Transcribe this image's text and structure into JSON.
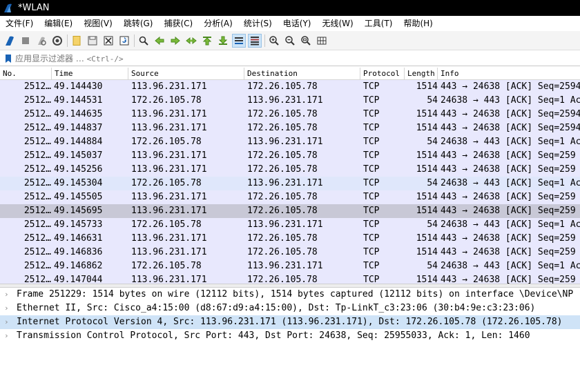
{
  "window": {
    "title": "*WLAN"
  },
  "menu": [
    "文件(F)",
    "编辑(E)",
    "视图(V)",
    "跳转(G)",
    "捕获(C)",
    "分析(A)",
    "统计(S)",
    "电话(Y)",
    "无线(W)",
    "工具(T)",
    "帮助(H)"
  ],
  "toolbar": {
    "icons": [
      "start-capture-icon",
      "stop-capture-icon",
      "restart-capture-icon",
      "capture-options-icon",
      "open-file-icon",
      "save-file-icon",
      "close-file-icon",
      "reload-file-icon",
      "find-packet-icon",
      "go-back-icon",
      "go-forward-icon",
      "go-to-packet-icon",
      "go-first-icon",
      "go-last-icon",
      "autoscroll-icon",
      "colorize-icon",
      "zoom-in-icon",
      "zoom-out-icon",
      "normal-size-icon",
      "resize-columns-icon"
    ],
    "active": [
      "autoscroll-icon",
      "colorize-icon"
    ]
  },
  "filter": {
    "placeholder": "应用显示过滤器 …",
    "shortcut": "<Ctrl-/>"
  },
  "packet_list": {
    "columns": [
      "No.",
      "Time",
      "Source",
      "Destination",
      "Protocol",
      "Length",
      "Info"
    ],
    "rows": [
      {
        "no": "2512…",
        "time": "49.144430",
        "src": "113.96.231.171",
        "dst": "172.26.105.78",
        "proto": "TCP",
        "len": "1514",
        "info": "443 → 24638 [ACK] Seq=2594"
      },
      {
        "no": "2512…",
        "time": "49.144531",
        "src": "172.26.105.78",
        "dst": "113.96.231.171",
        "proto": "TCP",
        "len": "54",
        "info": "24638 → 443 [ACK] Seq=1 Ac"
      },
      {
        "no": "2512…",
        "time": "49.144635",
        "src": "113.96.231.171",
        "dst": "172.26.105.78",
        "proto": "TCP",
        "len": "1514",
        "info": "443 → 24638 [ACK] Seq=2594"
      },
      {
        "no": "2512…",
        "time": "49.144837",
        "src": "113.96.231.171",
        "dst": "172.26.105.78",
        "proto": "TCP",
        "len": "1514",
        "info": "443 → 24638 [ACK] Seq=2594"
      },
      {
        "no": "2512…",
        "time": "49.144884",
        "src": "172.26.105.78",
        "dst": "113.96.231.171",
        "proto": "TCP",
        "len": "54",
        "info": "24638 → 443 [ACK] Seq=1 Ac"
      },
      {
        "no": "2512…",
        "time": "49.145037",
        "src": "113.96.231.171",
        "dst": "172.26.105.78",
        "proto": "TCP",
        "len": "1514",
        "info": "443 → 24638 [ACK] Seq=259"
      },
      {
        "no": "2512…",
        "time": "49.145256",
        "src": "113.96.231.171",
        "dst": "172.26.105.78",
        "proto": "TCP",
        "len": "1514",
        "info": "443 → 24638 [ACK] Seq=259"
      },
      {
        "no": "2512…",
        "time": "49.145304",
        "src": "172.26.105.78",
        "dst": "113.96.231.171",
        "proto": "TCP",
        "len": "54",
        "info": "24638 → 443 [ACK] Seq=1 Ac"
      },
      {
        "no": "2512…",
        "time": "49.145505",
        "src": "113.96.231.171",
        "dst": "172.26.105.78",
        "proto": "TCP",
        "len": "1514",
        "info": "443 → 24638 [ACK] Seq=259"
      },
      {
        "no": "2512…",
        "time": "49.145695",
        "src": "113.96.231.171",
        "dst": "172.26.105.78",
        "proto": "TCP",
        "len": "1514",
        "info": "443 → 24638 [ACK] Seq=259"
      },
      {
        "no": "2512…",
        "time": "49.145733",
        "src": "172.26.105.78",
        "dst": "113.96.231.171",
        "proto": "TCP",
        "len": "54",
        "info": "24638 → 443 [ACK] Seq=1 Ac"
      },
      {
        "no": "2512…",
        "time": "49.146631",
        "src": "113.96.231.171",
        "dst": "172.26.105.78",
        "proto": "TCP",
        "len": "1514",
        "info": "443 → 24638 [ACK] Seq=259"
      },
      {
        "no": "2512…",
        "time": "49.146836",
        "src": "113.96.231.171",
        "dst": "172.26.105.78",
        "proto": "TCP",
        "len": "1514",
        "info": "443 → 24638 [ACK] Seq=259"
      },
      {
        "no": "2512…",
        "time": "49.146862",
        "src": "172.26.105.78",
        "dst": "113.96.231.171",
        "proto": "TCP",
        "len": "54",
        "info": "24638 → 443 [ACK] Seq=1 Ac"
      },
      {
        "no": "2512…",
        "time": "49.147044",
        "src": "113.96.231.171",
        "dst": "172.26.105.78",
        "proto": "TCP",
        "len": "1514",
        "info": "443 → 24638 [ACK] Seq=259"
      }
    ],
    "highlighted_row": 7,
    "selected_row": 9
  },
  "details": {
    "rows": [
      "Frame 251229: 1514 bytes on wire (12112 bits), 1514 bytes captured (12112 bits) on interface \\Device\\NP",
      "Ethernet II, Src: Cisco_a4:15:00 (d8:67:d9:a4:15:00), Dst: Tp-LinkT_c3:23:06 (30:b4:9e:c3:23:06)",
      "Internet Protocol Version 4, Src: 113.96.231.171 (113.96.231.171), Dst: 172.26.105.78 (172.26.105.78)",
      "Transmission Control Protocol, Src Port: 443, Dst Port: 24638, Seq: 25955033, Ack: 1, Len: 1460"
    ],
    "selected_row": 2,
    "expander_glyph": "›"
  },
  "colors": {
    "titlebar": "#000000",
    "row_tcp": "#e8e8fd",
    "row_highlight": "#dfe7fb",
    "row_selected": "#c8c8d6",
    "detail_selected": "#cfe3f7",
    "accent": "#1a63b5"
  }
}
